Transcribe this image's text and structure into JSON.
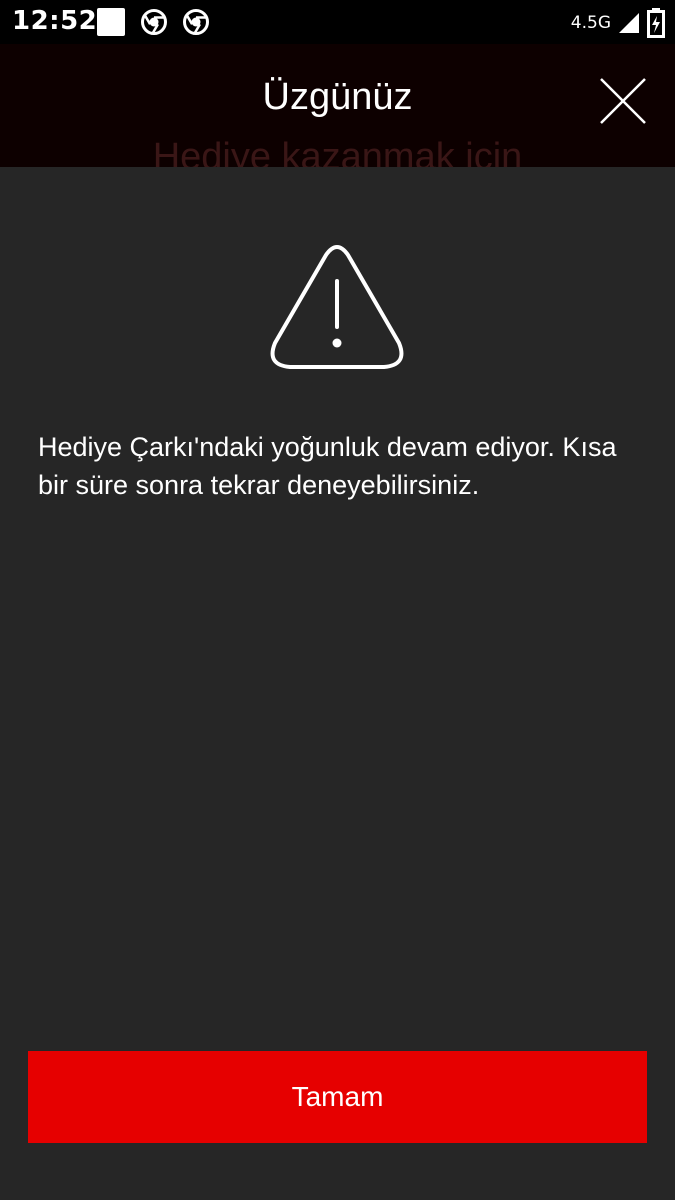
{
  "status_bar": {
    "time": "12:52",
    "network": "4.5G",
    "icons": [
      "notification-square-icon",
      "chrome-icon",
      "chrome-icon",
      "signal-icon",
      "battery-charging-icon"
    ]
  },
  "dialog": {
    "title": "Üzgünüz",
    "behind_text": "Hediye kazanmak için",
    "icon": "warning-icon",
    "message": "Hediye Çarkı'ndaki yoğunluk devam ediyor. Kısa bir süre sonra tekrar deneyebilirsiniz.",
    "ok_label": "Tamam"
  },
  "colors": {
    "background": "#262626",
    "header": "#0d0000",
    "accent": "#e60000"
  }
}
